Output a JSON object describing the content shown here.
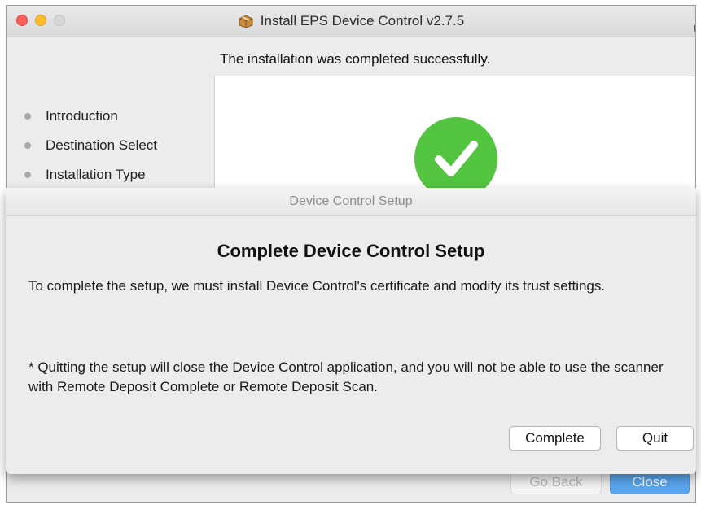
{
  "installer": {
    "title": "Install EPS Device Control v2.7.5",
    "headline": "The installation was completed successfully.",
    "steps": [
      {
        "label": "Introduction"
      },
      {
        "label": "Destination Select"
      },
      {
        "label": "Installation Type"
      }
    ],
    "buttons": {
      "go_back": "Go Back",
      "close": "Close"
    },
    "icons": {
      "app": "package-icon",
      "status": "checkmark-icon"
    },
    "colors": {
      "accent": "#5aa7ef",
      "success": "#53c43f"
    }
  },
  "setup_dialog": {
    "window_title": "Device Control Setup",
    "heading": "Complete Device Control Setup",
    "body": "To complete the setup, we must install Device Control's certificate and modify its trust settings.",
    "note": "* Quitting the setup will close the Device Control application, and you will not be able to use the scanner with Remote Deposit Complete or Remote Deposit Scan.",
    "buttons": {
      "complete": "Complete",
      "quit": "Quit"
    }
  }
}
